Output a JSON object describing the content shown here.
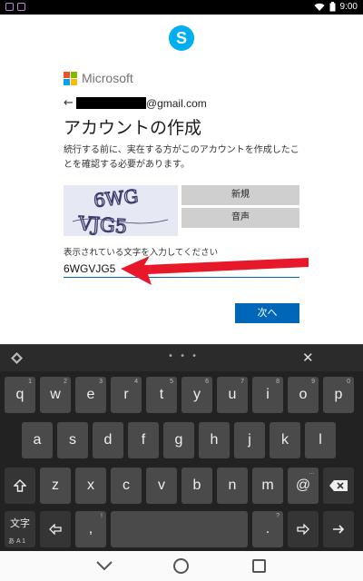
{
  "status_bar": {
    "time": "9:00"
  },
  "microsoft": {
    "brand": "Microsoft"
  },
  "account": {
    "email_domain": "@gmail.com"
  },
  "page": {
    "title": "アカウントの作成",
    "description": "続行する前に、実在する方がこのアカウントを作成したことを確認する必要があります。",
    "captcha_text": "6WG VJG5",
    "new_button": "新規",
    "audio_button": "音声",
    "input_label": "表示されている文字を入力してください",
    "input_value": "6WGVJG5",
    "next_button": "次へ"
  },
  "keyboard": {
    "row1": [
      {
        "key": "q",
        "hint": "1"
      },
      {
        "key": "w",
        "hint": "2"
      },
      {
        "key": "e",
        "hint": "3"
      },
      {
        "key": "r",
        "hint": "4"
      },
      {
        "key": "t",
        "hint": "5"
      },
      {
        "key": "y",
        "hint": "6"
      },
      {
        "key": "u",
        "hint": "7"
      },
      {
        "key": "i",
        "hint": "8"
      },
      {
        "key": "o",
        "hint": "9"
      },
      {
        "key": "p",
        "hint": "0"
      }
    ],
    "row2": [
      "a",
      "s",
      "d",
      "f",
      "g",
      "h",
      "j",
      "k",
      "l"
    ],
    "row3": [
      "z",
      "x",
      "c",
      "v",
      "b",
      "n",
      "m"
    ],
    "at_key": "@",
    "at_hint": "…",
    "mode_key": "文字",
    "mode_sub": "あ A 1",
    "comma_key": ",",
    "comma_hint": "!",
    "period_key": ".",
    "period_hint": "?",
    "dots": "• • •",
    "close": "✕"
  }
}
